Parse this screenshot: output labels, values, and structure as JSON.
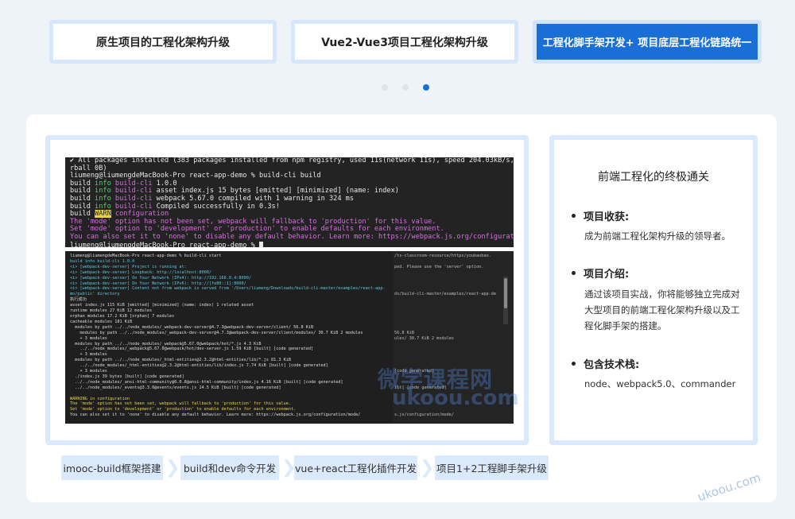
{
  "tabs": [
    {
      "label": "原生项目的工程化架构升级"
    },
    {
      "label": "Vue2-Vue3项目工程化架构升级"
    },
    {
      "label": "工程化脚手架开发+ 项目底层工程化链路统一"
    }
  ],
  "carousel": {
    "active_index": 2,
    "count": 3
  },
  "terminal_top": [
    {
      "t": "✔ All packages installed (383 packages installed from npm registry, used 11s(network 11s), speed 204.03kB/s, json 347(",
      "c": ""
    },
    {
      "t": "rball 0B)",
      "c": ""
    },
    {
      "t": "liumeng@liumengdeMacBook-Pro react-app-demo % build-cli build",
      "c": ""
    },
    {
      "pre": "build ",
      "b": "info",
      "mid": " build-cli",
      "t": " 1.0.0",
      "c": "blue"
    },
    {
      "pre": "build ",
      "b": "info",
      "mid": " build-cli",
      "t": " asset index.js 15 bytes [emitted] [minimized] (name: index)",
      "c": "blue"
    },
    {
      "pre": "build ",
      "b": "info",
      "mid": " build-cli",
      "t": " webpack 5.67.0 compiled with 1 warning in 324 ms",
      "c": "blue"
    },
    {
      "pre": "build ",
      "b": "info",
      "mid": " build-cli",
      "t": " Compiled successfully in 0.3s!",
      "c": "blue"
    },
    {
      "pre": "build ",
      "warn": "WARN",
      "t": " configuration",
      "c": "warn"
    },
    {
      "t": "The 'mode' option has not been set, webpack will fallback to 'production' for this value.",
      "c": "purple"
    },
    {
      "t": "Set 'mode' option to 'development' or 'production' to enable defaults for each environment.",
      "c": "purple"
    },
    {
      "t": "You can also set it to 'none' to disable any default behavior. Learn more: https://webpack.js.org/configuration/mode/",
      "c": "purple"
    },
    {
      "t": "liumeng@liumengdeMacBook-Pro react-app-demo % ",
      "c": "cursor"
    }
  ],
  "terminal_bottom_a": [
    {
      "t": "liumeng@liumengdeMacBook-Pro react-app-demo % build-cli start",
      "c": ""
    },
    {
      "t": "build info build-cli 1.0.0",
      "c": "blue"
    },
    {
      "t": "<i> [webpack-dev-server] Project is running at:",
      "c": "blue"
    },
    {
      "t": "<i> [webpack-dev-server] Loopback: http://localhost:8000/",
      "c": "blue"
    },
    {
      "t": "<i> [webpack-dev-server] On Your Network (IPv4): http://192.168.0.4:8000/",
      "c": "blue"
    },
    {
      "t": "<i> [webpack-dev-server] On Your Network (IPv6): http://[fe80::1]:8000/",
      "c": "blue"
    },
    {
      "t": "<i> [webpack-dev-server] Content not from webpack is served from '/Users/liumeng/Downloads/build-cli-master/examples/react-app-",
      "c": "blue"
    },
    {
      "t": "mo/public' directory",
      "c": "blue"
    },
    {
      "t": "执行成功",
      "c": ""
    },
    {
      "t": "asset index.js 115 KiB [emitted] [minimized] (name: index) 1 related asset",
      "c": ""
    },
    {
      "t": "runtime modules 27 KiB 12 modules",
      "c": ""
    },
    {
      "t": "orphan modules 17.2 KiB [orphan] 7 modules",
      "c": ""
    },
    {
      "t": "cacheable modules 181 KiB",
      "c": ""
    },
    {
      "t": "  modules by path ../../node_modules/_webpack-dev-server@4.7.3@webpack-dev-server/client/ 56.8 KiB",
      "c": ""
    },
    {
      "t": "    modules by path ../../node_modules/_webpack-dev-server@4.7.3@webpack-dev-server/client/modules/ 30.7 KiB 2 modules",
      "c": ""
    },
    {
      "t": "    + 3 modules",
      "c": ""
    },
    {
      "t": "  modules by path ../../node_modules/_webpack@5.67.0@webpack/hot/*.js 4.3 KiB",
      "c": ""
    },
    {
      "t": "    ../../node_modules/_webpack@5.67.0@webpack/hot/dev-server.js 1.59 KiB [built] [code generated]",
      "c": ""
    },
    {
      "t": "    + 3 modules",
      "c": ""
    },
    {
      "t": "  modules by path ../../node_modules/_html-entities@2.3.2@html-entities/lib/*.js 81.3 KiB",
      "c": ""
    },
    {
      "t": "    ../../node_modules/_html-entities@2.3.2@html-entities/lib/index.js 7.74 KiB [built] [code generated]",
      "c": ""
    },
    {
      "t": "    + 3 modules",
      "c": ""
    },
    {
      "t": "  ./index.js 39 bytes [built] [code generated]",
      "c": ""
    },
    {
      "t": "  ../../node_modules/_ansi-html-community@0.0.8@ansi-html-community/index.js 4.16 KiB [built] [code generated]",
      "c": ""
    },
    {
      "t": "  ../../node_modules/_events@3.3.0@events/events.js 14.5 KiB [built] [code generated]",
      "c": ""
    },
    {
      "t": "",
      "c": ""
    },
    {
      "t": "WARNING in configuration",
      "c": "yellow"
    },
    {
      "t": "The 'mode' option has not been set, webpack will fallback to 'production' for this value.",
      "c": "yellow"
    },
    {
      "t": "Set 'mode' option to 'development' or 'production' to enable defaults for each environment.",
      "c": "yellow"
    },
    {
      "t": "You can also set it to 'none' to disable any default behavior. Learn more: https://webpack.js.org/configuration/mode/",
      "c": ""
    },
    {
      "t": "",
      "c": ""
    },
    {
      "t": "webpack 5.67.0 compiled with 1 warning in 3819 ms",
      "c": ""
    }
  ],
  "terminal_bottom_b": [
    "/ts-classroom-resource/https/youbaobao.",
    "",
    "ped. Please use the 'server' option.",
    "",
    "",
    "",
    "",
    "ds/build-cli-master/examples/react-app-de",
    "",
    "",
    "",
    "",
    "",
    "",
    "56.8 KiB",
    "ules/ 30.7 KiB 2 modules",
    "",
    "",
    "",
    "",
    "",
    "[code generated]",
    "",
    "",
    "ilt] [code generated]",
    "",
    "",
    "",
    "",
    "s.js/configuration/mode/"
  ],
  "watermark": {
    "line1": "微学课程网",
    "line2": "ukoou.com"
  },
  "info": {
    "title": "前端工程化的终极通关",
    "sections": [
      {
        "heading": "项目收获:",
        "text": "成为前端工程化架构升级的领导者。"
      },
      {
        "heading": "项目介绍:",
        "text": "通过该项目实战，你将能够独立完成对大型项目的前端工程化架构升级以及工程化脚手架的搭建。"
      },
      {
        "heading": "包含技术栈:",
        "text": "node、webpack5.0、commander"
      }
    ]
  },
  "steps": [
    {
      "label": "imooc-build框架搭建"
    },
    {
      "label": "build和dev命令开发"
    },
    {
      "label": "vue+react工程化插件开发"
    },
    {
      "label": "项目1+2工程脚手架升级"
    }
  ],
  "corner_watermark": "ukoou.com",
  "colors": {
    "accent": "#1a6fd6",
    "frame": "#dbe9fc",
    "page_bg": "#eef3fa"
  }
}
